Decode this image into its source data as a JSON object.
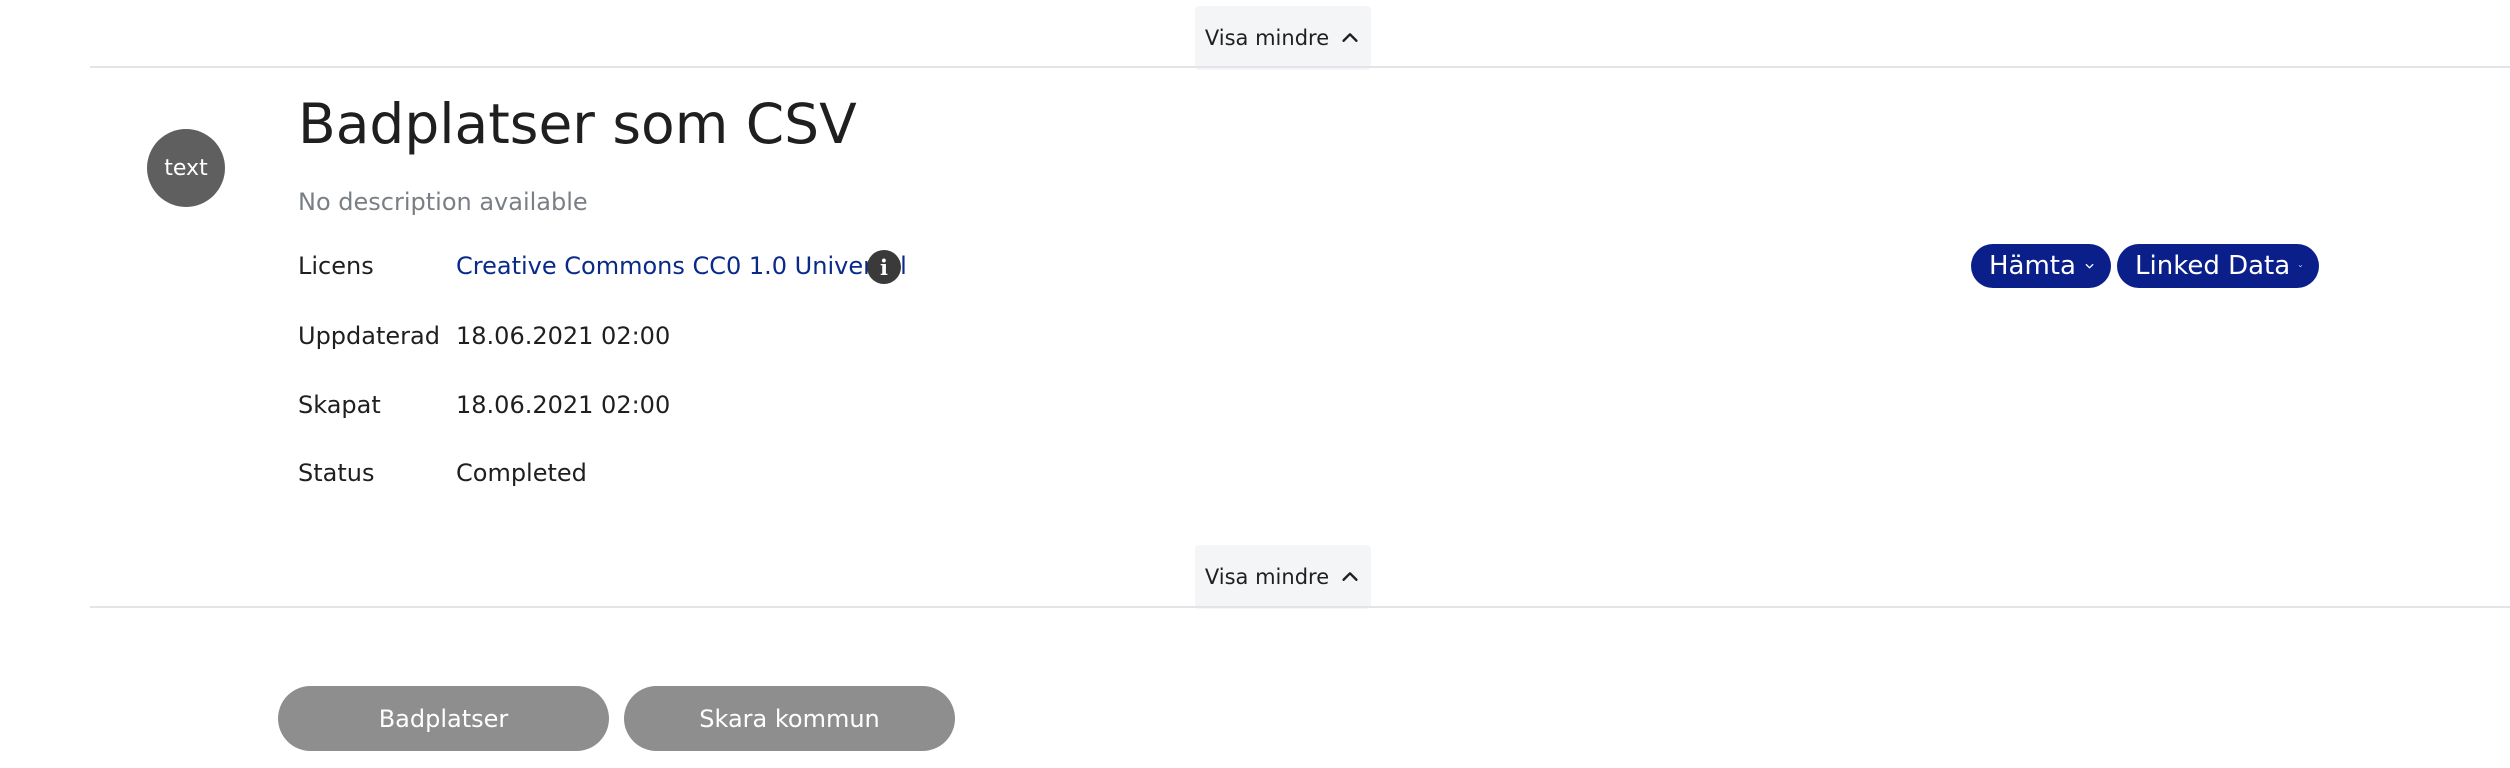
{
  "toggle": {
    "label": "Visa mindre"
  },
  "resource": {
    "format_badge": "text",
    "title": "Badplatser som CSV",
    "description": "No description available"
  },
  "meta": {
    "license_label": "Licens",
    "license_value": "Creative Commons CC0 1.0 Universal",
    "updated_label": "Uppdaterad",
    "updated_value": "18.06.2021 02:00",
    "created_label": "Skapat",
    "created_value": "18.06.2021 02:00",
    "status_label": "Status",
    "status_value": "Completed"
  },
  "actions": {
    "download_label": "Hämta",
    "linked_data_label": "Linked Data"
  },
  "tags": [
    "Badplatser",
    "Skara kommun"
  ],
  "colors": {
    "primary": "#0a1f8a",
    "link": "#0a2a8a",
    "tag_background": "#8e8e8e",
    "badge_background": "#5f5f5f"
  }
}
